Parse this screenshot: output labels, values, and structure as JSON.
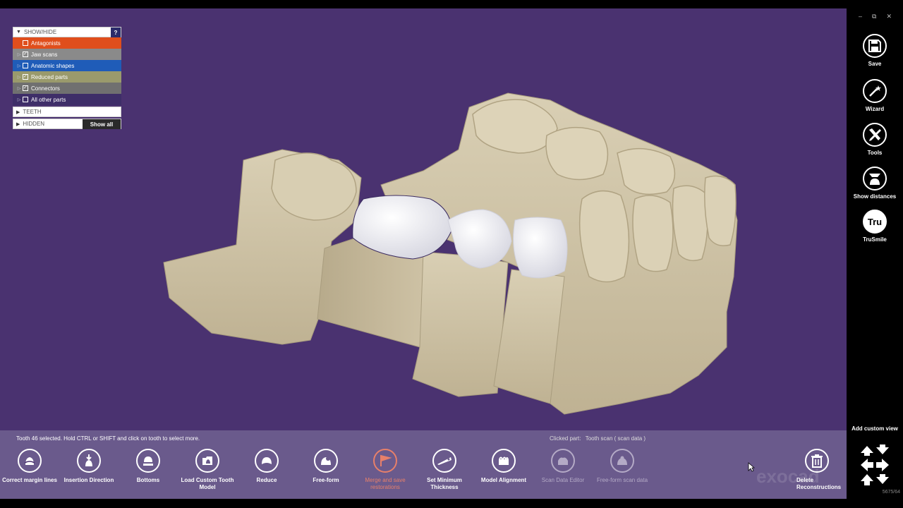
{
  "panel": {
    "title": "SHOW/HIDE",
    "help": "?",
    "items": [
      {
        "label": "Antagonists",
        "checked": false,
        "color": "#e04e1c"
      },
      {
        "label": "Jaw scans",
        "checked": true,
        "color": "#8a8a8a"
      },
      {
        "label": "Anatomic shapes",
        "checked": false,
        "color": "#1f5cb8"
      },
      {
        "label": "Reduced parts",
        "checked": true,
        "color": "#9a9a6c"
      },
      {
        "label": "Connectors",
        "checked": true,
        "color": "#707070"
      },
      {
        "label": "All other parts",
        "checked": false,
        "color": "#3e2e68"
      }
    ],
    "teeth": "TEETH",
    "hidden": "HIDDEN",
    "show_all": "Show all"
  },
  "status": {
    "left": "Tooth 46 selected. Hold CTRL or SHIFT and click on tooth to select more.",
    "clicked_label": "Clicked part:",
    "clicked_value": "Tooth scan ( scan data )"
  },
  "tools": [
    {
      "label": "Correct margin lines",
      "icon": "margin-line-icon",
      "state": "normal"
    },
    {
      "label": "Insertion Direction",
      "icon": "insertion-direction-icon",
      "state": "normal"
    },
    {
      "label": "Bottoms",
      "icon": "bottoms-icon",
      "state": "normal"
    },
    {
      "label": "Load Custom Tooth Model",
      "icon": "load-model-icon",
      "state": "normal"
    },
    {
      "label": "Reduce",
      "icon": "reduce-icon",
      "state": "normal"
    },
    {
      "label": "Free-form",
      "icon": "free-form-icon",
      "state": "normal"
    },
    {
      "label": "Merge and save restorations",
      "icon": "merge-flag-icon",
      "state": "highlight"
    },
    {
      "label": "Set Minimum Thickness",
      "icon": "thickness-icon",
      "state": "normal"
    },
    {
      "label": "Model Alignment",
      "icon": "model-alignment-icon",
      "state": "normal"
    },
    {
      "label": "Scan Data Editor",
      "icon": "scan-editor-icon",
      "state": "disabled"
    },
    {
      "label": "Free-form scan data",
      "icon": "free-form-scan-icon",
      "state": "disabled"
    }
  ],
  "delete_tool": {
    "label": "Delete Reconstructions",
    "icon": "trash-icon"
  },
  "watermark": "exocad",
  "sidebar": {
    "items": [
      {
        "label": "Save",
        "icon": "save-icon"
      },
      {
        "label": "Wizard",
        "icon": "wizard-icon"
      },
      {
        "label": "Tools",
        "icon": "tools-icon"
      },
      {
        "label": "Show distances",
        "icon": "distances-icon"
      },
      {
        "label": "TruSmile",
        "icon": "trusmile-icon",
        "glyph": "Tru"
      }
    ],
    "window_controls": {
      "minimize": "–",
      "restore": "⧉",
      "close": "✕"
    },
    "custom_view": "Add custom view",
    "version": "5675/64"
  },
  "colors": {
    "viewport": "#4a3270",
    "toolbar": "#6a5a8c",
    "model": "#cfc3a6",
    "restoration": "#f1f1f6",
    "highlight": "#e8806a"
  }
}
